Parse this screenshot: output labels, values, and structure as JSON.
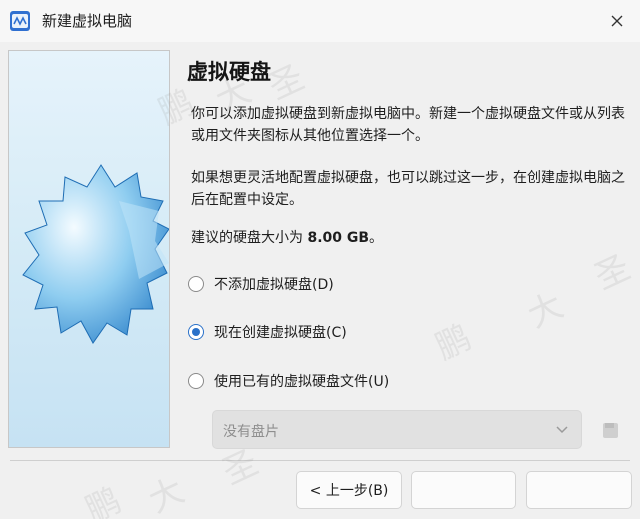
{
  "window": {
    "title": "新建虚拟电脑",
    "app_icon": "virtualbox-icon",
    "close_icon": "close-icon"
  },
  "page": {
    "heading": "虚拟硬盘",
    "paragraph1": "你可以添加虚拟硬盘到新虚拟电脑中。新建一个虚拟硬盘文件或从列表或用文件夹图标从其他位置选择一个。",
    "paragraph2": "如果想更灵活地配置虚拟硬盘，也可以跳过这一步，在创建虚拟电脑之后在配置中设定。",
    "recommend_prefix": "建议的硬盘大小为 ",
    "recommend_size": "8.00 GB",
    "recommend_suffix": "。"
  },
  "options": [
    {
      "label": "不添加虚拟硬盘(D)",
      "checked": false
    },
    {
      "label": "现在创建虚拟硬盘(C)",
      "checked": true
    },
    {
      "label": "使用已有的虚拟硬盘文件(U)",
      "checked": false
    }
  ],
  "disk_select": {
    "value": "没有盘片",
    "enabled": false,
    "folder_icon": "folder-icon"
  },
  "buttons": {
    "back": "< 上一步(B)",
    "next": "",
    "cancel": ""
  },
  "watermarks": [
    "鹏",
    "大",
    "圣",
    "鹏",
    "大",
    "圣",
    "鹏",
    "大",
    "圣"
  ],
  "colors": {
    "accent": "#2a71c9",
    "panel_bg": "#f0f0f0"
  }
}
